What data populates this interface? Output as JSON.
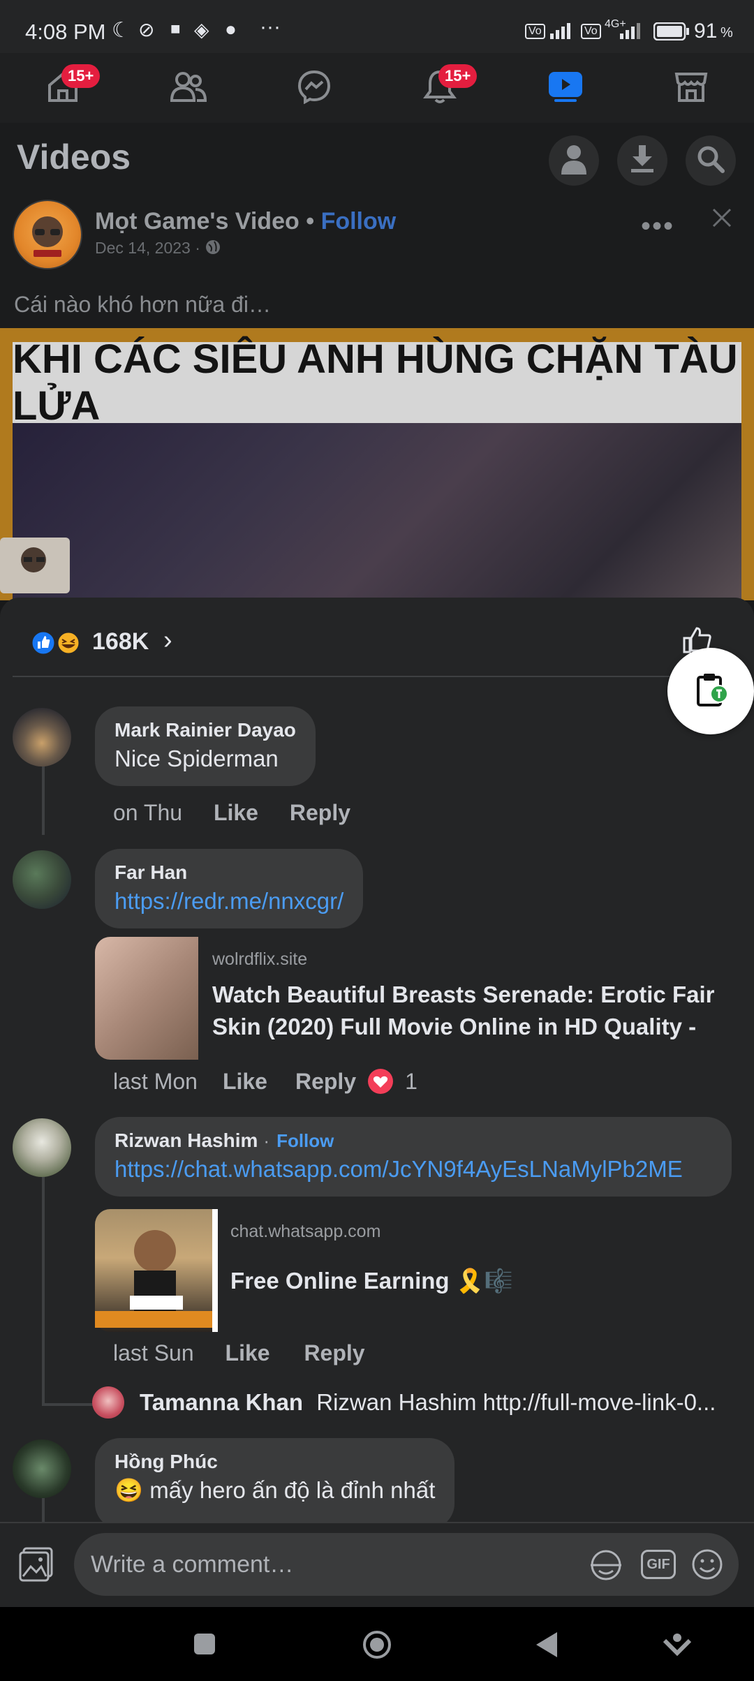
{
  "status_bar": {
    "time": "4:08 PM",
    "battery": "91",
    "battery_unit": "%",
    "network": "4G+"
  },
  "top_nav": {
    "items": [
      {
        "icon": "home-icon",
        "badge": "15+"
      },
      {
        "icon": "friends-icon"
      },
      {
        "icon": "messenger-icon"
      },
      {
        "icon": "bell-icon",
        "badge": "15+"
      },
      {
        "icon": "video-icon",
        "active": true
      },
      {
        "icon": "marketplace-icon"
      }
    ]
  },
  "header": {
    "title": "Videos"
  },
  "post": {
    "author": "Mọt Game's Video",
    "separator": "•",
    "follow_label": "Follow",
    "date": "Dec 14, 2023",
    "date_sep": "·",
    "text": "Cái nào khó hơn nữa đi…",
    "video_banner": "KHI CÁC SIÊU ANH HÙNG CHẶN TÀU LỬA"
  },
  "reactions": {
    "count": "168K",
    "chevron": "›"
  },
  "comments": [
    {
      "name": "Mark Rainier Dayao",
      "text": "Nice Spiderman",
      "time": "on Thu",
      "like": "Like",
      "reply": "Reply"
    },
    {
      "name": "Far Han",
      "link": "https://redr.me/nnxcgr/",
      "preview_domain": "wolrdflix.site",
      "preview_title": "Watch Beautiful Breasts Serenade: Erotic Fair Skin (2020) Full Movie Online in HD Quality -",
      "time": "last Mon",
      "like": "Like",
      "reply": "Reply",
      "reaction_count": "1"
    },
    {
      "name": "Rizwan Hashim",
      "name_sep": "·",
      "follow_label": "Follow",
      "link": "https://chat.whatsapp.com/JcYN9f4AyEsLNaMylPb2ME",
      "preview_domain": "chat.whatsapp.com",
      "preview_title": "Free Online Earning 🎗️🎼",
      "time": "last Sun",
      "like": "Like",
      "reply": "Reply",
      "reply_preview": {
        "name": "Tamanna Khan",
        "text": "Rizwan Hashim http://full-move-link-0..."
      }
    },
    {
      "name": "Hồng Phúc",
      "text": "😆 mấy hero ấn độ là đỉnh nhất"
    }
  ],
  "composer": {
    "placeholder": "Write a comment…",
    "gif_label": "GIF"
  },
  "colors": {
    "background": "#18191a",
    "sheet": "#242526",
    "bubble": "#3a3b3c",
    "link": "#4b9cf2",
    "accent_blue": "#1877f2",
    "badge_red": "#e41e3f"
  }
}
